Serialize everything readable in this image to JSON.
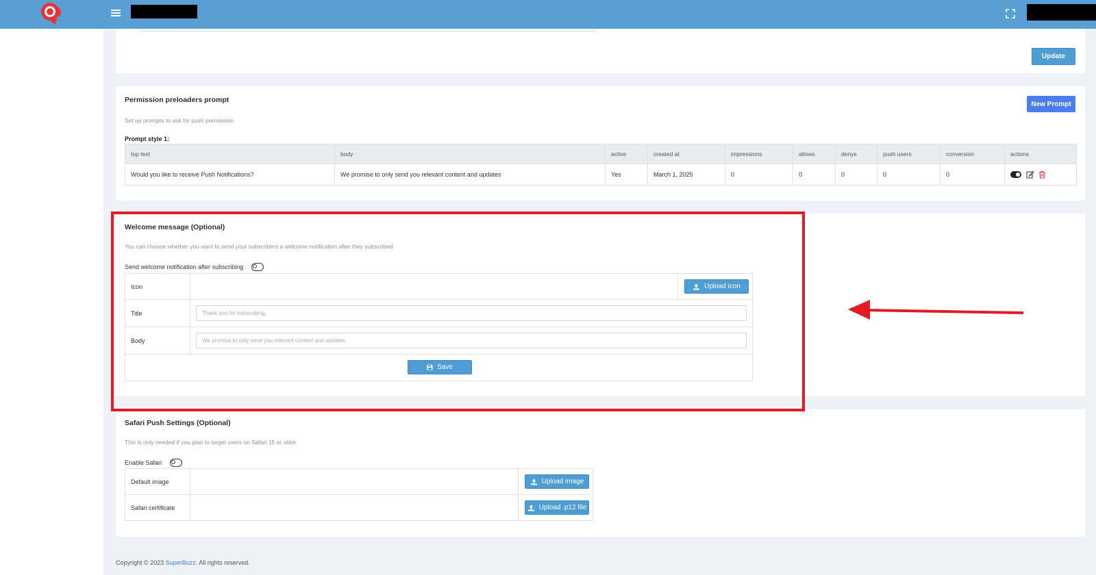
{
  "header": {
    "logo": "superbuzz-logo",
    "menu_icon": "hamburger-icon",
    "fullscreen_icon": "fullscreen-icon",
    "colors": {
      "bar": "#5a9fd4"
    }
  },
  "top_card": {
    "update_label": "Update"
  },
  "prompts": {
    "title": "Permission preloaders prompt",
    "subtitle": "Set up prompts to ask for push permission",
    "new_prompt_label": "New Prompt",
    "style_label": "Prompt style 1:",
    "columns": [
      "top text",
      "body",
      "active",
      "created at",
      "impressions",
      "allows",
      "denys",
      "push users",
      "conversion",
      "actions"
    ],
    "rows": [
      {
        "top_text": "Would you like to receive Push Notifications?",
        "body": "We promise to only send you relevant content and updates",
        "active": "Yes",
        "created_at": "March 1, 2025",
        "impressions": "0",
        "allows": "0",
        "denys": "0",
        "push_users": "0",
        "conversion": "0"
      }
    ]
  },
  "welcome": {
    "title": "Welcome message (Optional)",
    "subtitle": "You can choose whether you want to send your subscribers a welcome notification after they subscribed.",
    "toggle_label": "Send welcome notification after subscribing",
    "icon_label": "Icon",
    "upload_icon_label": "Upload icon",
    "title_label": "Title",
    "title_placeholder": "Thank you for subscribing.",
    "body_label": "Body",
    "body_placeholder": "We promise to only send you relevant content and updates.",
    "save_label": "Save",
    "highlight_color": "#e01b24"
  },
  "safari": {
    "title": "Safari Push Settings (Optional)",
    "subtitle": "This is only needed if you plan to target users on Safari 15 or older.",
    "toggle_label": "Enable Safari",
    "default_image_label": "Default image",
    "upload_image_label": "Upload image",
    "certificate_label": "Safari certificate",
    "upload_p12_label": "Upload .p12 file"
  },
  "footer": {
    "prefix": "Copyright © 2023 ",
    "brand": "SuperBuzz.",
    "suffix": " All rights reserved."
  }
}
